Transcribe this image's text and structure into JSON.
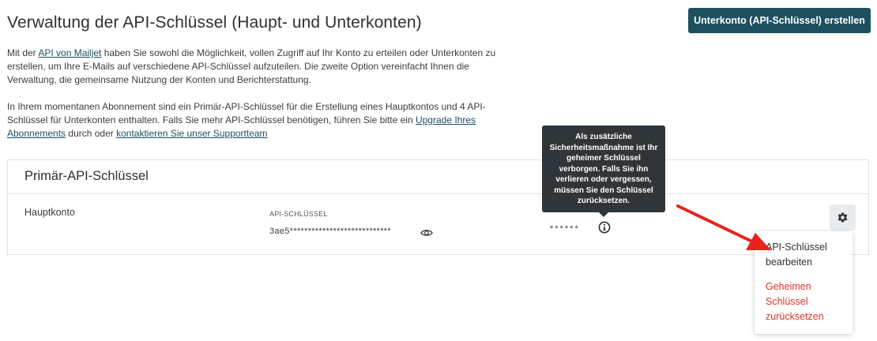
{
  "header": {
    "title": "Verwaltung der API-Schlüssel (Haupt- und Unterkonten)",
    "create_button": "Unterkonto (API-Schlüssel) erstellen"
  },
  "intro": {
    "p1_before": "Mit der ",
    "p1_link": "API von Mailjet",
    "p1_after": " haben Sie sowohl die Möglichkeit, vollen Zugriff auf Ihr Konto zu erteilen oder Unterkonten zu erstellen, um Ihre E-Mails auf verschiedene API-Schlüssel aufzuteilen. Die zweite Option vereinfacht Ihnen die Verwaltung, die gemeinsame Nutzung der Konten und Berichterstattung.",
    "p2_before": "In Ihrem momentanen Abonnement sind ein Primär-API-Schlüssel für die Erstellung eines Hauptkontos und 4 API-Schlüssel für Unterkonten enthalten. Falls Sie mehr API-Schlüssel benötigen, führen Sie bitte ein ",
    "p2_link1": "Upgrade Ihres Abonnements",
    "p2_middle": " durch oder ",
    "p2_link2": "kontaktieren Sie unser Supportteam"
  },
  "primary_card": {
    "title": "Primär-API-Schlüssel",
    "account_name": "Hauptkonto",
    "api_key_label": "API-SCHLÜSSEL",
    "api_key_value": "3ae5****************************",
    "secret_value": "******"
  },
  "tooltip": {
    "text": "Als zusätzliche Sicherheitsmaßnahme ist Ihr geheimer Schlüssel verborgen. Falls Sie ihn verlieren oder vergessen, müssen Sie den Schlüssel zurücksetzen."
  },
  "dropdown": {
    "edit_label": "API-Schlüssel bearbeiten",
    "reset_label": "Geheimen Schlüssel zurücksetzen"
  },
  "colors": {
    "brand_button": "#1d4f5e",
    "danger_text": "#e0322b",
    "annotation_arrow": "#e8231f",
    "tooltip_bg": "#2f3538"
  }
}
